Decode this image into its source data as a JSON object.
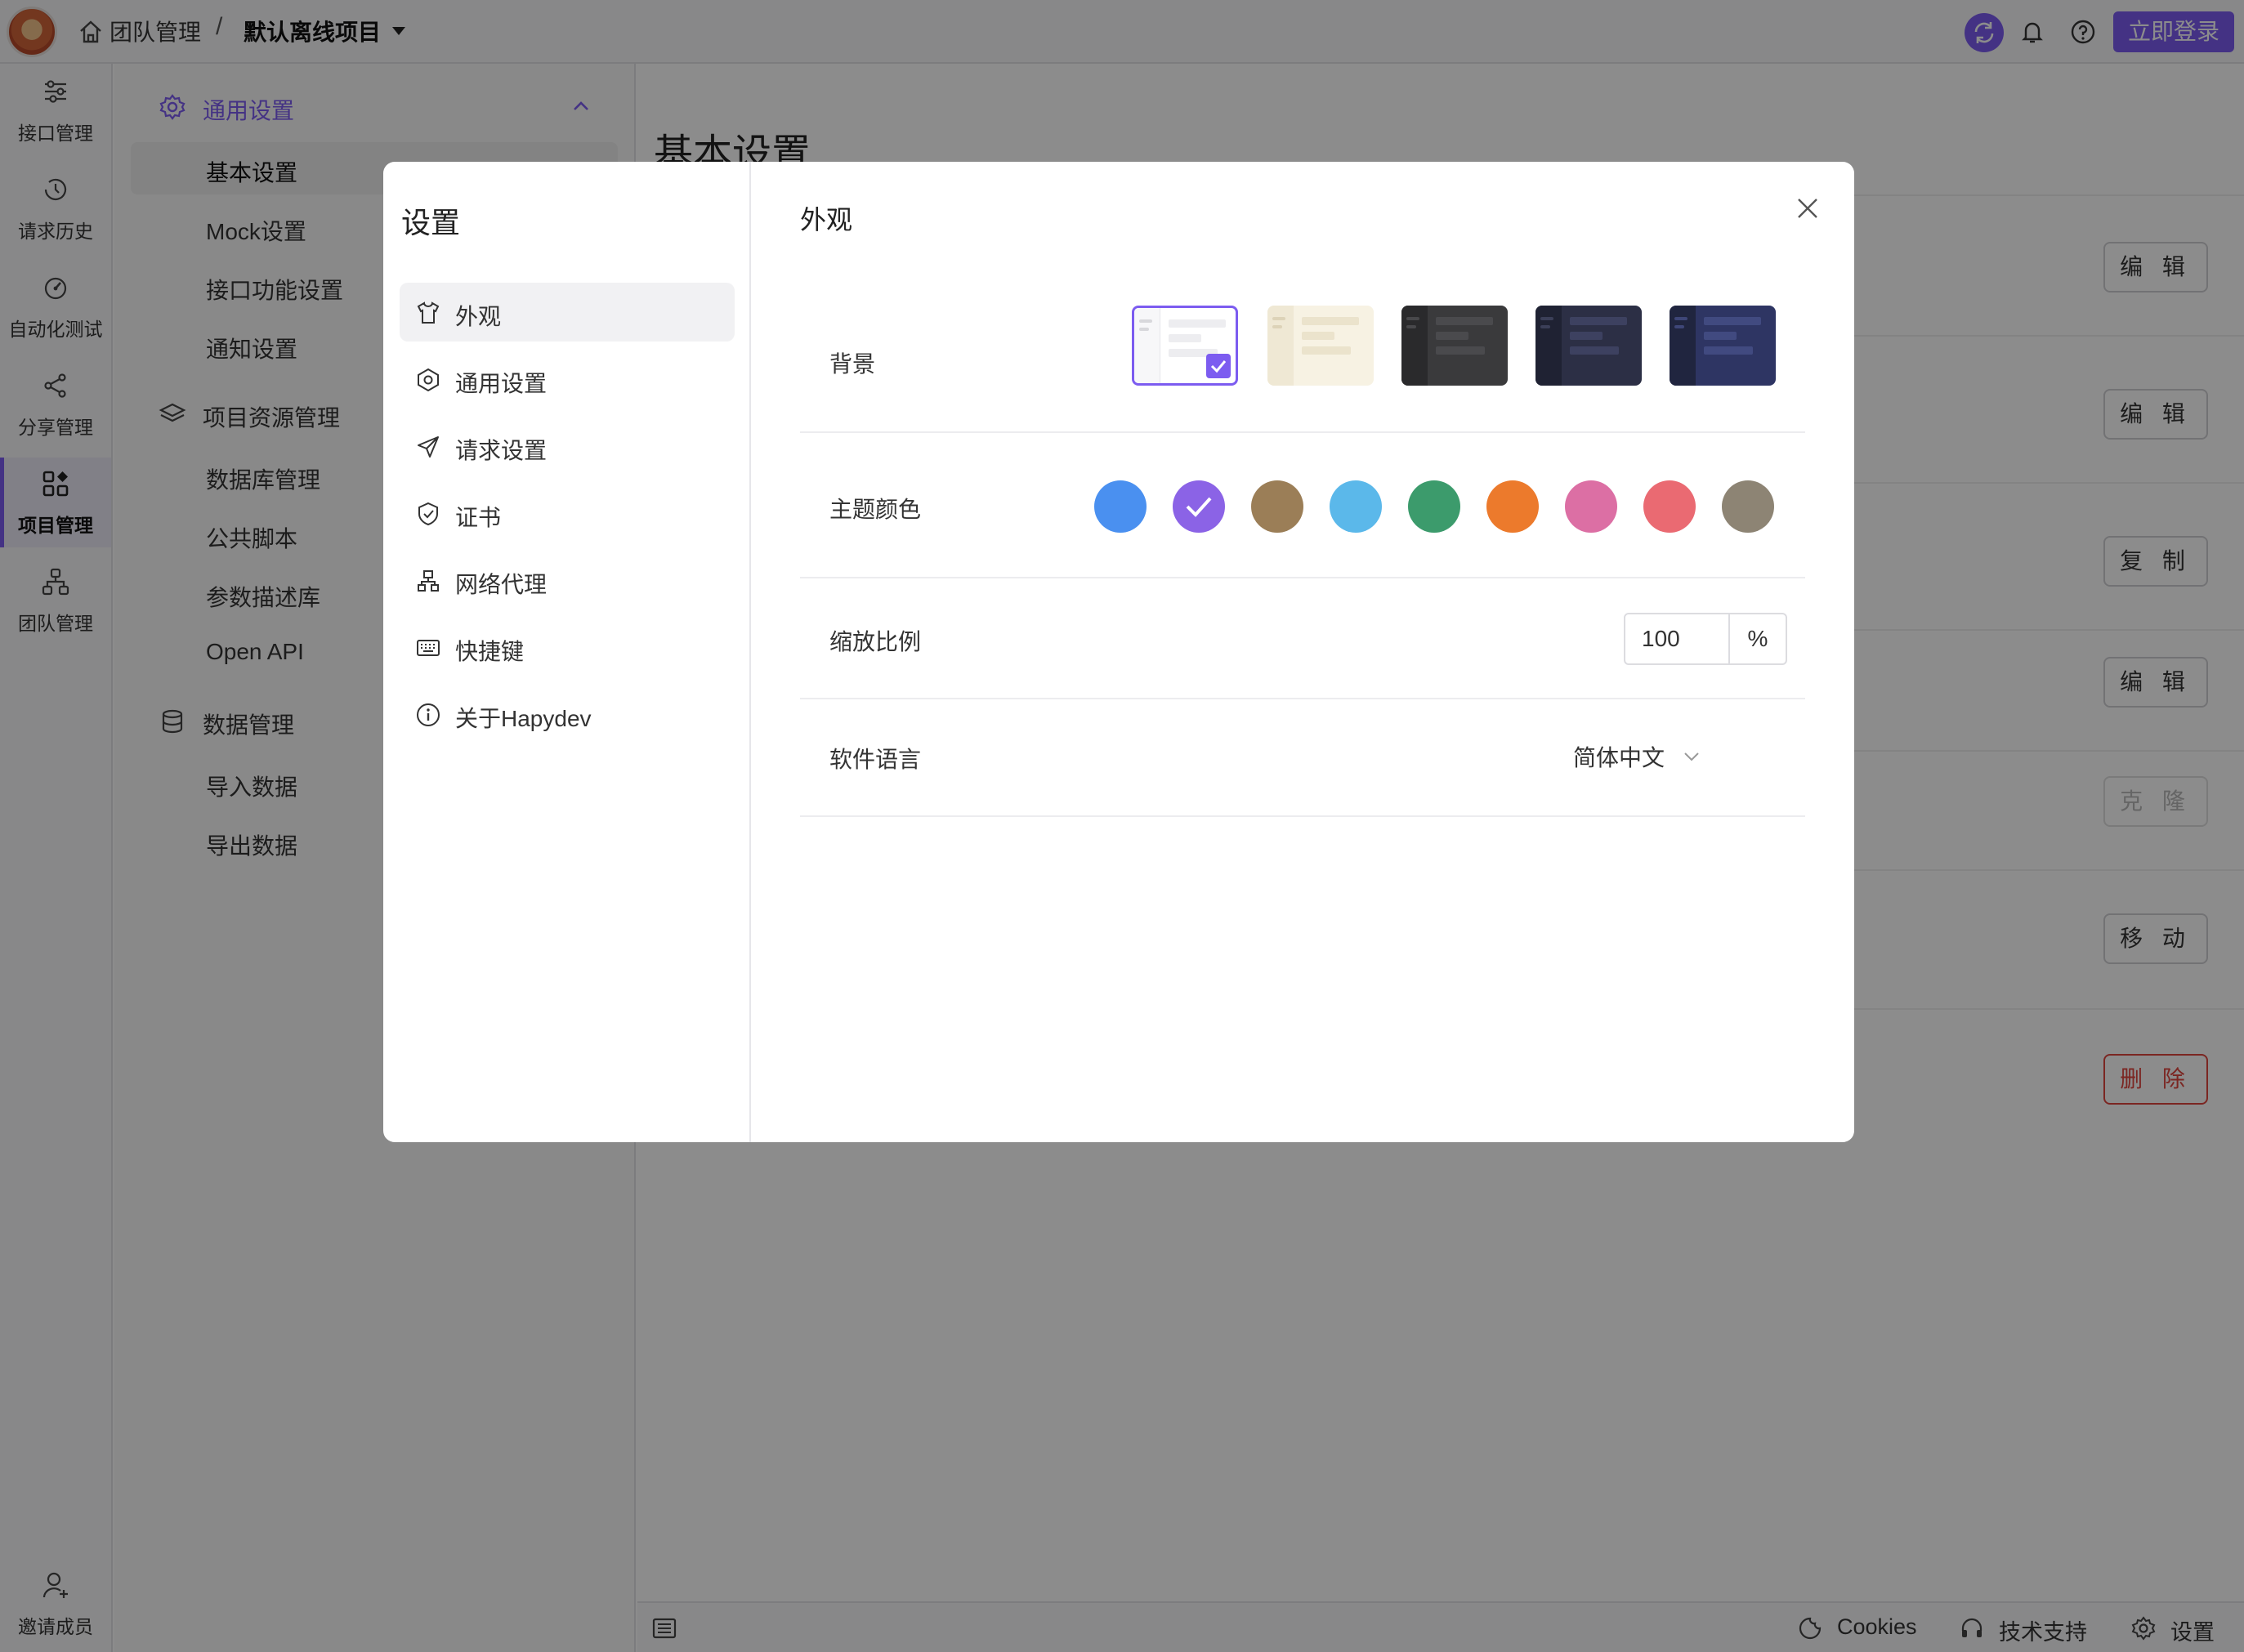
{
  "topbar": {
    "breadcrumb_team": "团队管理",
    "breadcrumb_separator": "/",
    "breadcrumb_project": "默认离线项目",
    "login_label": "立即登录",
    "accent": "#7c5cf0"
  },
  "rail": {
    "items": [
      {
        "label": "接口管理",
        "icon": "sliders-icon"
      },
      {
        "label": "请求历史",
        "icon": "history-icon"
      },
      {
        "label": "自动化测试",
        "icon": "gauge-icon"
      },
      {
        "label": "分享管理",
        "icon": "share-icon"
      },
      {
        "label": "项目管理",
        "icon": "grid-icon",
        "active": true
      },
      {
        "label": "团队管理",
        "icon": "team-tree-icon"
      }
    ],
    "invite_label": "邀请成员"
  },
  "subnav": {
    "general_group": "通用设置",
    "general_items": [
      "基本设置",
      "Mock设置",
      "接口功能设置",
      "通知设置"
    ],
    "resource_group": "项目资源管理",
    "resource_items": [
      "数据库管理",
      "公共脚本",
      "参数描述库",
      "Open API"
    ],
    "data_group": "数据管理",
    "data_items": [
      "导入数据",
      "导出数据"
    ]
  },
  "main": {
    "title": "基本设置",
    "buttons": [
      "编 辑",
      "编 辑",
      "复 制",
      "编 辑",
      "克 隆",
      "移 动",
      "删 除"
    ]
  },
  "statusbar": {
    "cookies": "Cookies",
    "support": "技术支持",
    "settings": "设置"
  },
  "modal": {
    "title": "设置",
    "menu": [
      {
        "label": "外观",
        "icon": "shirt-icon",
        "active": true
      },
      {
        "label": "通用设置",
        "icon": "hexagon-gear-icon"
      },
      {
        "label": "请求设置",
        "icon": "send-icon"
      },
      {
        "label": "证书",
        "icon": "shield-check-icon"
      },
      {
        "label": "网络代理",
        "icon": "network-icon"
      },
      {
        "label": "快捷键",
        "icon": "keyboard-icon"
      },
      {
        "label": "关于Hapydev",
        "icon": "info-icon"
      }
    ],
    "section_title": "外观",
    "background_label": "背景",
    "background_options": [
      "light",
      "cream",
      "dark",
      "navy",
      "indigo"
    ],
    "background_selected": "light",
    "theme_color_label": "主题颜色",
    "theme_colors": [
      "#4a90f0",
      "#8b63e6",
      "#9b7e57",
      "#5bb8ea",
      "#3c9b6c",
      "#ec7a2c",
      "#dc6fa4",
      "#ea6a72",
      "#8d8474"
    ],
    "theme_selected_index": 1,
    "zoom_label": "缩放比例",
    "zoom_value": "100",
    "zoom_unit": "%",
    "language_label": "软件语言",
    "language_value": "简体中文"
  }
}
